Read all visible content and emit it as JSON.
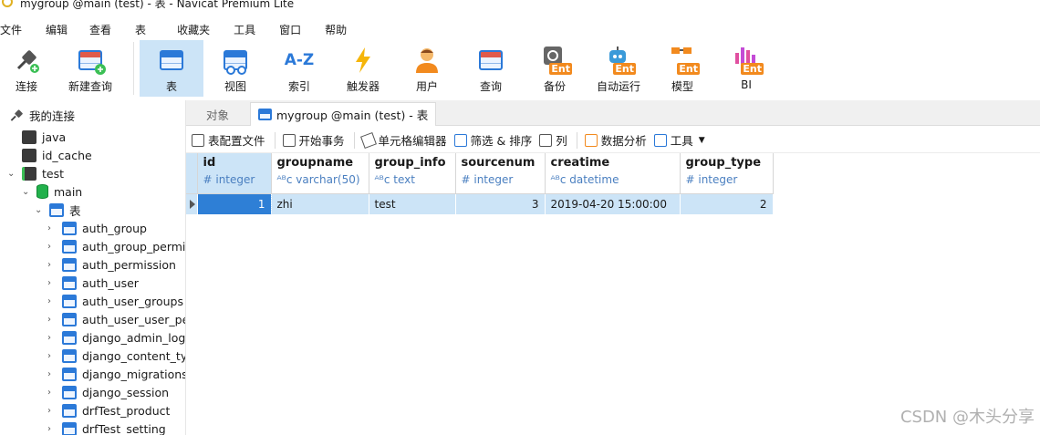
{
  "window": {
    "title": "mygroup @main (test) - 表 - Navicat Premium Lite"
  },
  "menu": [
    "文件",
    "编辑",
    "查看",
    "表",
    "收藏夹",
    "工具",
    "窗口",
    "帮助"
  ],
  "toolbar": [
    {
      "label": "连接",
      "icon": "plug-icon"
    },
    {
      "label": "新建查询",
      "icon": "new-query-icon"
    },
    {
      "label": "表",
      "icon": "table-icon",
      "active": true
    },
    {
      "label": "视图",
      "icon": "view-icon"
    },
    {
      "label": "索引",
      "icon": "index-az-icon",
      "glyph": "A-Z"
    },
    {
      "label": "触发器",
      "icon": "lightning-icon"
    },
    {
      "label": "用户",
      "icon": "user-icon"
    },
    {
      "label": "查询",
      "icon": "query-icon"
    },
    {
      "label": "备份",
      "icon": "backup-icon",
      "badge": "Ent"
    },
    {
      "label": "自动运行",
      "icon": "robot-icon",
      "badge": "Ent"
    },
    {
      "label": "模型",
      "icon": "model-icon",
      "badge": "Ent"
    },
    {
      "label": "BI",
      "icon": "bi-chart-icon",
      "badge": "Ent"
    }
  ],
  "sidebar": {
    "root": "我的连接",
    "connections": [
      "java",
      "id_cache",
      "test"
    ],
    "database": "main",
    "tables_folder": "表",
    "tables": [
      "auth_group",
      "auth_group_permis",
      "auth_permission",
      "auth_user",
      "auth_user_groups",
      "auth_user_user_peri",
      "django_admin_log",
      "django_content_typ",
      "django_migrations",
      "django_session",
      "drfTest_product",
      "drfTest_setting"
    ]
  },
  "tabs": {
    "objects": "对象",
    "active": "mygroup @main (test) - 表"
  },
  "subtoolbar": [
    "表配置文件",
    "开始事务",
    "单元格编辑器",
    "筛选 & 排序",
    "列",
    "数据分析",
    "工具"
  ],
  "grid": {
    "columns": [
      {
        "name": "id",
        "type": "# integer"
      },
      {
        "name": "groupname",
        "type": "varchar(50)"
      },
      {
        "name": "group_info",
        "type": "text"
      },
      {
        "name": "sourcenum",
        "type": "# integer"
      },
      {
        "name": "creatime",
        "type": "datetime"
      },
      {
        "name": "group_type",
        "type": "# integer"
      }
    ],
    "rows": [
      {
        "id": "1",
        "groupname": "zhi",
        "group_info": "test",
        "sourcenum": "3",
        "creatime": "2019-04-20 15:00:00",
        "group_type": "2"
      }
    ],
    "type_prefix": "ᴬᴮc"
  },
  "watermark": "CSDN @木头分享",
  "colors": {
    "accent": "#2b79d8",
    "selection": "#cce4f7",
    "selected_cell": "#2e7fd6",
    "ent_badge": "#f28a1e"
  }
}
